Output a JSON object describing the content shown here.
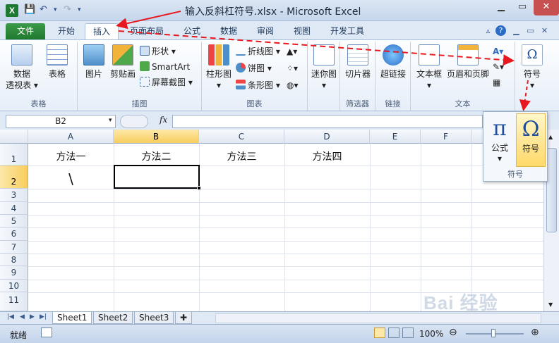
{
  "window": {
    "title": "输入反斜杠符号.xlsx - Microsoft Excel",
    "app_icon": "X"
  },
  "tabs": [
    "文件",
    "开始",
    "插入",
    "页面布局",
    "公式",
    "数据",
    "审阅",
    "视图",
    "开发工具"
  ],
  "ribbon": {
    "tables": {
      "pivot": "数据\n透视表",
      "pivot_l1": "数据",
      "pivot_l2": "透视表",
      "table": "表格",
      "label": "表格"
    },
    "illustrations": {
      "picture": "图片",
      "clipart": "剪贴画",
      "shapes": "形状",
      "smartart": "SmartArt",
      "screenshot": "屏幕截图",
      "label": "插图"
    },
    "charts": {
      "column": "柱形图",
      "line": "折线图",
      "pie": "饼图",
      "bar": "条形图",
      "label": "图表"
    },
    "sparklines": {
      "sparkline": "迷你图"
    },
    "filter": {
      "slicer": "切片器",
      "label": "筛选器"
    },
    "links": {
      "hyperlink": "超链接",
      "label": "链接"
    },
    "text": {
      "textbox": "文本框",
      "header_footer": "页眉和页脚",
      "label": "文本"
    },
    "symbols": {
      "symbol": "符号",
      "omega": "Ω"
    }
  },
  "popup": {
    "equation": "公式",
    "symbol": "符号",
    "pi": "π",
    "omega": "Ω",
    "label": "符号"
  },
  "formula_bar": {
    "name_box": "B2",
    "fx": "fx",
    "value": ""
  },
  "columns": [
    "A",
    "B",
    "C",
    "D",
    "E",
    "F"
  ],
  "rows": [
    "1",
    "2",
    "3",
    "4",
    "5",
    "6",
    "7",
    "8",
    "9",
    "10",
    "11"
  ],
  "cells": {
    "A1": "方法一",
    "B1": "方法二",
    "C1": "方法三",
    "D1": "方法四",
    "A2": "\\"
  },
  "sheets": [
    "Sheet1",
    "Sheet2",
    "Sheet3"
  ],
  "status": {
    "ready": "就绪",
    "zoom": "100%"
  },
  "watermark": "Bai 经验"
}
